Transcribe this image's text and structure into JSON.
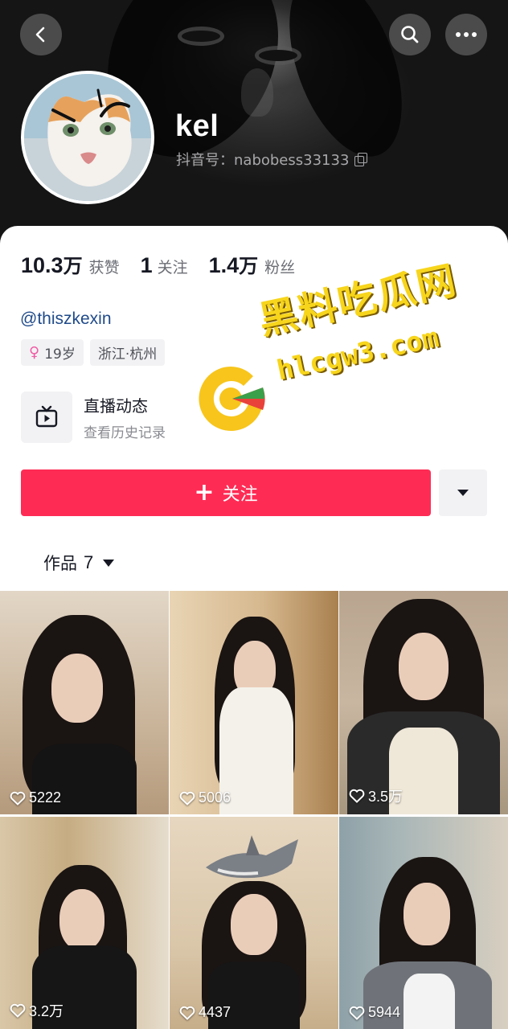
{
  "profile": {
    "name": "kel",
    "douyin_id": "抖音号：nabobess33133",
    "handle": "@thiszkexin"
  },
  "stats": [
    {
      "num": "10.3",
      "unit": "万",
      "label": "获赞"
    },
    {
      "num": "1",
      "unit": "",
      "label": "关注"
    },
    {
      "num": "1.4",
      "unit": "万",
      "label": "粉丝"
    }
  ],
  "tags": {
    "age": "19岁",
    "location": "浙江·杭州"
  },
  "live": {
    "title": "直播动态",
    "subtitle": "查看历史记录"
  },
  "actions": {
    "follow_label": "关注"
  },
  "works": {
    "label": "作品",
    "count": "7"
  },
  "videos": [
    {
      "likes": "5222"
    },
    {
      "likes": "5006"
    },
    {
      "likes": "3.5万"
    },
    {
      "likes": "3.2万"
    },
    {
      "likes": "4437"
    },
    {
      "likes": "5944"
    }
  ],
  "watermark": {
    "title": "黑料吃瓜网",
    "url": "hlcgw3.com"
  },
  "colors": {
    "accent": "#fe2c55",
    "watermark": "#f7d51c",
    "handle": "#1f4a8a"
  }
}
